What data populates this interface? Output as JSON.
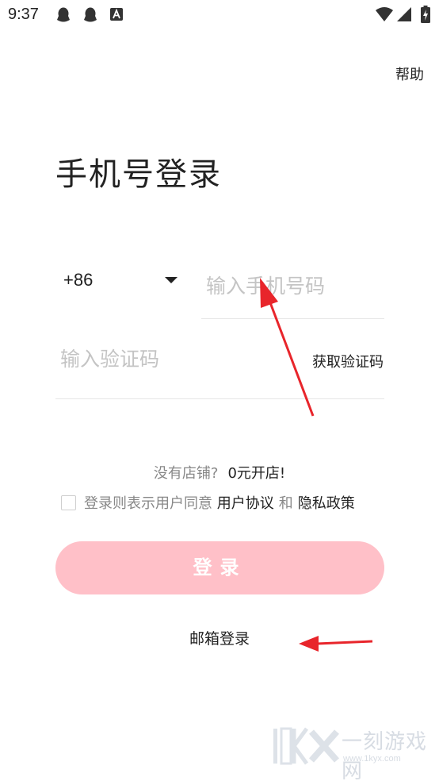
{
  "status_bar": {
    "time": "9:37",
    "icons": [
      "qq-icon",
      "qq-icon",
      "text-a-icon",
      "wifi-icon",
      "signal-icon",
      "battery-charging-icon"
    ]
  },
  "header": {
    "help_label": "帮助"
  },
  "title": "手机号登录",
  "phone": {
    "country_code": "+86",
    "placeholder": "输入手机号码",
    "value": ""
  },
  "verification": {
    "placeholder": "输入验证码",
    "value": "",
    "get_code_label": "获取验证码"
  },
  "open_shop": {
    "prompt": "没有店铺?",
    "link": "0元开店!"
  },
  "agreement": {
    "checked": false,
    "prefix": "登录则表示用户同意",
    "user_agreement": "用户协议",
    "and": "和",
    "privacy_policy": "隐私政策"
  },
  "login_button": {
    "label": "登录",
    "color": "#ffc0c8"
  },
  "email_login": {
    "label": "邮箱登录"
  },
  "annotations": {
    "arrow_color": "#e8252b"
  },
  "watermark": {
    "logo": "1KYX",
    "brand": "一刻游戏网",
    "url": "www.1kyx.com"
  }
}
